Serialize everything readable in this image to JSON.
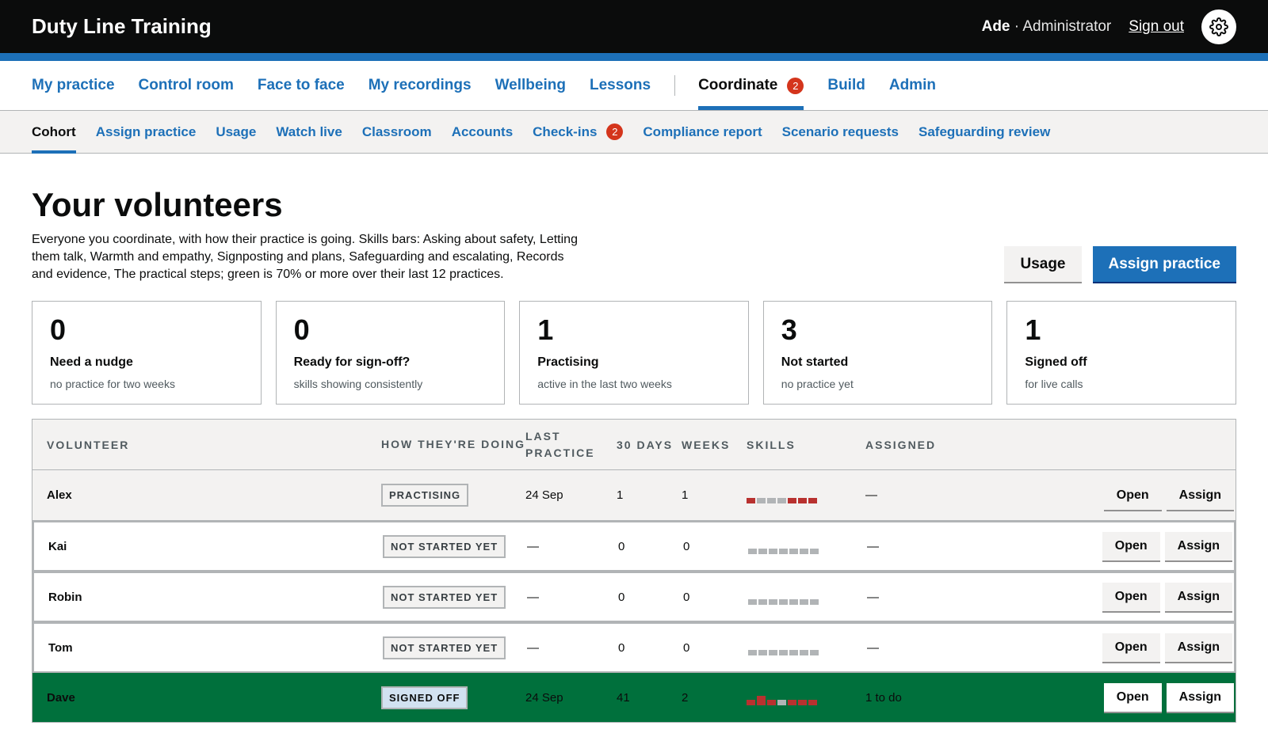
{
  "app": {
    "title": "Duty Line Training"
  },
  "user": {
    "name": "Ade",
    "role": " · Administrator",
    "sign_out": "Sign out"
  },
  "primary_nav": [
    {
      "label": "My practice"
    },
    {
      "label": "Control room"
    },
    {
      "label": "Face to face"
    },
    {
      "label": "My recordings"
    },
    {
      "label": "Wellbeing"
    },
    {
      "label": "Lessons"
    },
    {
      "label": "Coordinate",
      "badge": "2",
      "active": true
    },
    {
      "label": "Build"
    },
    {
      "label": "Admin"
    }
  ],
  "secondary_nav": [
    {
      "label": "Cohort",
      "active": true
    },
    {
      "label": "Assign practice"
    },
    {
      "label": "Usage"
    },
    {
      "label": "Watch live"
    },
    {
      "label": "Classroom"
    },
    {
      "label": "Accounts"
    },
    {
      "label": "Check-ins",
      "badge": "2"
    },
    {
      "label": "Compliance report"
    },
    {
      "label": "Scenario requests"
    },
    {
      "label": "Safeguarding review"
    }
  ],
  "page": {
    "title": "Your volunteers",
    "intro": "Everyone you coordinate, with how their practice is going. Skills bars: Asking about safety, Letting them talk, Warmth and empathy, Signposting and plans, Safeguarding and escalating, Records and evidence, The practical steps; green is 70% or more over their last 12 practices.",
    "usage_button": "Usage",
    "assign_button": "Assign practice"
  },
  "stats": [
    {
      "num": "0",
      "label": "Need a nudge",
      "sub": "no practice for two weeks"
    },
    {
      "num": "0",
      "label": "Ready for sign-off?",
      "sub": "skills showing consistently"
    },
    {
      "num": "1",
      "label": "Practising",
      "sub": "active in the last two weeks"
    },
    {
      "num": "3",
      "label": "Not started",
      "sub": "no practice yet"
    },
    {
      "num": "1",
      "label": "Signed off",
      "sub": "for live calls"
    }
  ],
  "table": {
    "headers": {
      "volunteer": "Volunteer",
      "how": "How they're doing",
      "last": "Last practice",
      "days30": "30 days",
      "weeks": "Weeks",
      "skills": "Skills",
      "assigned": "Assigned"
    },
    "open_label": "Open",
    "assign_label": "Assign",
    "colors": {
      "red": "#b8312f",
      "grey": "#b1b4b6",
      "green_row": "#00703c"
    },
    "rows": [
      {
        "name": "Alex",
        "status": "PRACTISING",
        "last": "24 Sep",
        "days30": "1",
        "weeks": "1",
        "assigned": "—",
        "skills": [
          {
            "c": "red",
            "h": 7
          },
          {
            "c": "grey",
            "h": 7
          },
          {
            "c": "grey",
            "h": 7
          },
          {
            "c": "grey",
            "h": 7
          },
          {
            "c": "red",
            "h": 7
          },
          {
            "c": "red",
            "h": 7
          },
          {
            "c": "red",
            "h": 7
          }
        ]
      },
      {
        "name": "Kai",
        "status": "NOT STARTED YET",
        "last": "—",
        "days30": "0",
        "weeks": "0",
        "assigned": "—",
        "skills": [
          {
            "c": "grey",
            "h": 7
          },
          {
            "c": "grey",
            "h": 7
          },
          {
            "c": "grey",
            "h": 7
          },
          {
            "c": "grey",
            "h": 7
          },
          {
            "c": "grey",
            "h": 7
          },
          {
            "c": "grey",
            "h": 7
          },
          {
            "c": "grey",
            "h": 7
          }
        ]
      },
      {
        "name": "Robin",
        "status": "NOT STARTED YET",
        "last": "—",
        "days30": "0",
        "weeks": "0",
        "assigned": "—",
        "skills": [
          {
            "c": "grey",
            "h": 7
          },
          {
            "c": "grey",
            "h": 7
          },
          {
            "c": "grey",
            "h": 7
          },
          {
            "c": "grey",
            "h": 7
          },
          {
            "c": "grey",
            "h": 7
          },
          {
            "c": "grey",
            "h": 7
          },
          {
            "c": "grey",
            "h": 7
          }
        ]
      },
      {
        "name": "Tom",
        "status": "NOT STARTED YET",
        "last": "—",
        "days30": "0",
        "weeks": "0",
        "assigned": "—",
        "skills": [
          {
            "c": "grey",
            "h": 7
          },
          {
            "c": "grey",
            "h": 7
          },
          {
            "c": "grey",
            "h": 7
          },
          {
            "c": "grey",
            "h": 7
          },
          {
            "c": "grey",
            "h": 7
          },
          {
            "c": "grey",
            "h": 7
          },
          {
            "c": "grey",
            "h": 7
          }
        ]
      },
      {
        "name": "Dave",
        "status": "SIGNED OFF",
        "last": "24 Sep",
        "days30": "41",
        "weeks": "2",
        "assigned": "1 to do",
        "skills": [
          {
            "c": "red",
            "h": 7
          },
          {
            "c": "red",
            "h": 12
          },
          {
            "c": "red",
            "h": 7
          },
          {
            "c": "grey",
            "h": 7
          },
          {
            "c": "red",
            "h": 7
          },
          {
            "c": "red",
            "h": 7
          },
          {
            "c": "red",
            "h": 7
          }
        ]
      }
    ]
  }
}
